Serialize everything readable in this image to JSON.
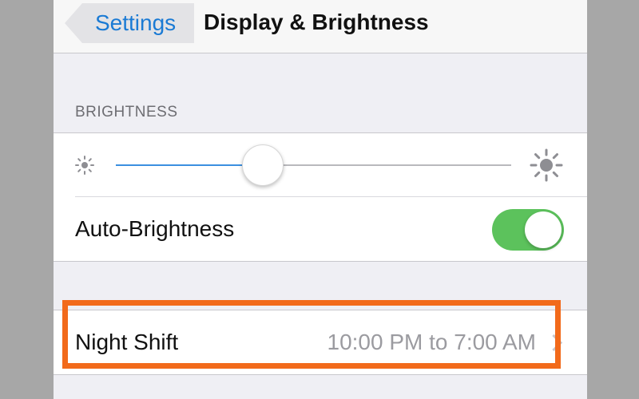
{
  "navbar": {
    "back_label": "Settings",
    "title": "Display & Brightness"
  },
  "brightness": {
    "section_header": "BRIGHTNESS",
    "slider_level": 0.37,
    "icons": {
      "min": "sun-small-icon",
      "max": "sun-large-icon"
    },
    "auto_brightness": {
      "label": "Auto-Brightness",
      "enabled": true
    }
  },
  "night_shift": {
    "label": "Night Shift",
    "value": "10:00 PM to 7:00 AM",
    "icon": "chevron-right-icon"
  },
  "colors": {
    "accent": "#1a7ad4",
    "toggle_on": "#5cc25c",
    "highlight": "#f26a1b"
  }
}
